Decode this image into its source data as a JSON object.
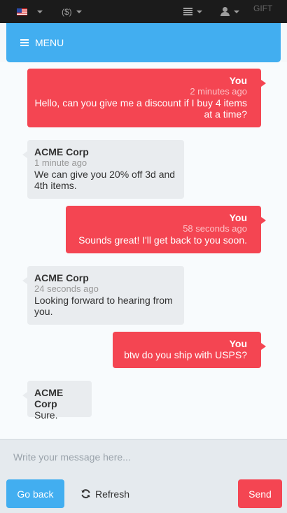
{
  "topbar": {
    "currency": "($)",
    "gift": "GIFT"
  },
  "menu": {
    "label": "MENU"
  },
  "messages": [
    {
      "from": "you",
      "author": "You",
      "time": "2 minutes ago",
      "text": "Hello, can you give me a discount if I buy 4 items at a time?"
    },
    {
      "from": "them",
      "author": "ACME Corp",
      "time": "1 minute ago",
      "text": "We can give you 20% off 3d and 4th items."
    },
    {
      "from": "you",
      "author": "You",
      "time": "58 seconds ago",
      "text": "Sounds great! I'll get back to you soon."
    },
    {
      "from": "them",
      "author": "ACME Corp",
      "time": "24 seconds ago",
      "text": "Looking forward to hearing from you."
    },
    {
      "from": "you",
      "author": "You",
      "time": "",
      "text": "btw do you ship with USPS?"
    },
    {
      "from": "them",
      "author": "ACME Corp",
      "time": "",
      "text": "Sure."
    }
  ],
  "composer": {
    "placeholder": "Write your message here...",
    "value": ""
  },
  "actions": {
    "back_label": "Go back",
    "refresh_label": "Refresh",
    "send_label": "Send"
  },
  "colors": {
    "topbar": "#1b1b1b",
    "primary": "#42aef0",
    "accent": "#f44552",
    "incoming_bubble": "#e9ecef"
  }
}
